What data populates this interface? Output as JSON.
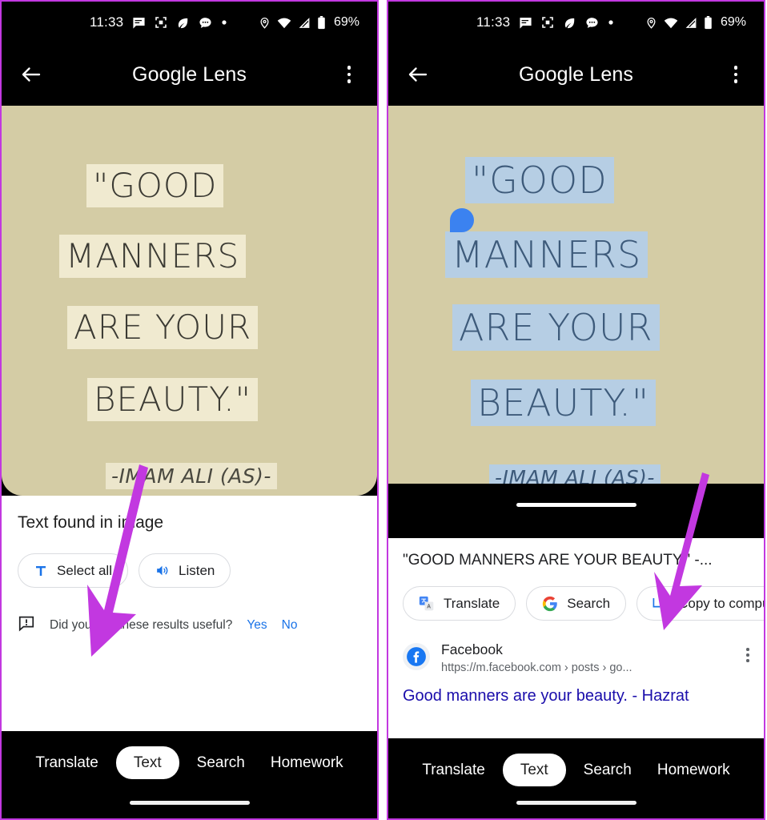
{
  "status_bar": {
    "time": "11:33",
    "battery_percent": "69%",
    "left_icons": [
      "message-icon",
      "screenshot-icon",
      "leaf-icon",
      "chat-bubble-icon",
      "dot-icon"
    ],
    "right_icons": [
      "location-icon",
      "wifi-icon",
      "signal-icon",
      "battery-icon"
    ]
  },
  "app_bar": {
    "title_bold": "Google",
    "title_light": " Lens",
    "back_icon": "back-arrow-icon",
    "overflow_icon": "kebab-menu-icon"
  },
  "quote": {
    "lines": [
      "\"GOOD",
      "MANNERS",
      "ARE YOUR",
      "BEAUTY.\""
    ],
    "attribution": "-IMAM ALI (AS)-",
    "photo_bg": "#d4cca5",
    "plain_highlight": "#f0ead0",
    "selection_highlight": "#b6cee4",
    "selection_handle_color": "#3b82f0"
  },
  "left_panel": {
    "sheet_title": "Text found in image",
    "actions": [
      {
        "label": "Select all",
        "icon": "text-select-icon"
      },
      {
        "label": "Listen",
        "icon": "speaker-icon"
      }
    ],
    "feedback": {
      "icon": "feedback-icon",
      "question": "Did you find these results useful?",
      "yes": "Yes",
      "no": "No"
    }
  },
  "right_panel": {
    "selected_text_preview": "\"GOOD MANNERS ARE YOUR BEAUTY.\" -...",
    "actions": [
      {
        "label": "Translate",
        "icon": "google-translate-icon"
      },
      {
        "label": "Search",
        "icon": "google-g-icon"
      },
      {
        "label": "Copy to computer",
        "icon": "copy-to-computer-icon"
      }
    ],
    "result": {
      "favicon": "facebook-icon",
      "site": "Facebook",
      "url": "https://m.facebook.com › posts › go...",
      "overflow_icon": "kebab-menu-icon",
      "link_title": "Good manners are your beauty. - Hazrat"
    }
  },
  "bottom_nav": {
    "items": [
      "Translate",
      "Text",
      "Search",
      "Homework"
    ],
    "active": "Text"
  },
  "annotations": {
    "arrow_color": "#c238e0",
    "arrow_count": 2
  }
}
